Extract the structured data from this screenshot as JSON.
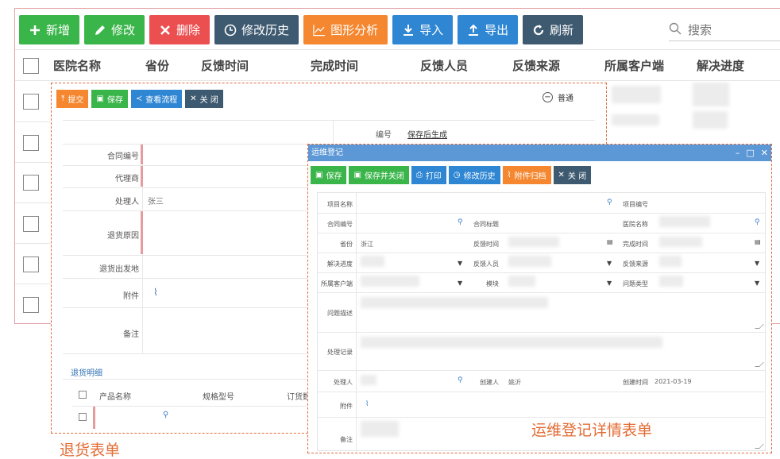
{
  "colors": {
    "green": "#3ab54a",
    "red": "#ec4f50",
    "dark": "#3e5a70",
    "orange": "#f4872f",
    "blue": "#2f86d3",
    "title_bar": "#5c97d6",
    "annotation": "#e36c34"
  },
  "toolbar": {
    "add": "新增",
    "edit": "修改",
    "delete": "删除",
    "history": "修改历史",
    "chart": "图形分析",
    "import": "导入",
    "export": "导出",
    "refresh": "刷新"
  },
  "search": {
    "placeholder": "搜索"
  },
  "grid": {
    "columns": [
      "医院名称",
      "省份",
      "反馈时间",
      "完成时间",
      "反馈人员",
      "反馈来源",
      "所属客户端",
      "解决进度"
    ]
  },
  "return_form": {
    "toolbar": {
      "submit": "提交",
      "save": "保存",
      "flow": "查看流程",
      "close": "关 闭"
    },
    "mode": "普通",
    "fields": {
      "number_label": "编号",
      "number_value": "保存后生成",
      "contract_label": "合同编号",
      "agent_label": "代理商",
      "handler_label": "处理人",
      "handler_value": "张三",
      "reason_label": "退货原因",
      "origin_label": "退货出发地",
      "attach_label": "附件",
      "remark_label": "备注"
    },
    "detail_section": "退货明细",
    "detail_columns": [
      "产品名称",
      "规格型号",
      "订货数"
    ]
  },
  "ops_dialog": {
    "title": "运维登记",
    "toolbar": {
      "save": "保存",
      "save_close": "保存并关闭",
      "print": "打印",
      "history": "修改历史",
      "archive": "附件归档",
      "close": "关 闭"
    },
    "fields": {
      "project_name": "项目名称",
      "project_no": "项目编号",
      "contract_no": "合同编号",
      "contract_title": "合同标题",
      "hospital_name": "医院名称",
      "province": "省份",
      "province_value": "浙江",
      "feedback_time": "反馈时间",
      "complete_time": "完成时间",
      "progress": "解决进度",
      "feedback_person": "反馈人员",
      "feedback_source": "反馈来源",
      "client": "所属客户端",
      "module": "模块",
      "issue_type": "问题类型",
      "issue_desc": "问题描述",
      "process_record": "处理记录",
      "handler": "处理人",
      "creator": "创建人",
      "creator_value": "姚沂",
      "create_time": "创建时间",
      "create_time_value": "2021-03-19",
      "attachment": "附件",
      "remark": "备注"
    }
  },
  "annotations": {
    "ops_form": "运维登记详情表单",
    "return_form": "退货表单"
  }
}
